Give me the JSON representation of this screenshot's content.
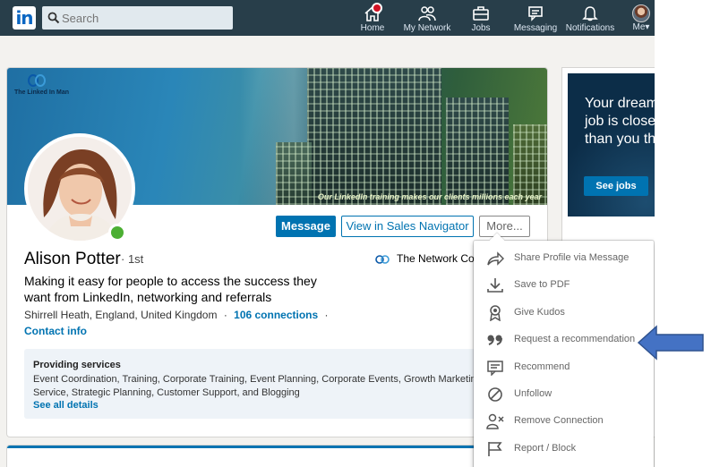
{
  "nav": {
    "logo_text": "in",
    "search_placeholder": "Search",
    "items": [
      {
        "label": "Home",
        "icon": "home-icon"
      },
      {
        "label": "My Network",
        "icon": "network-icon"
      },
      {
        "label": "Jobs",
        "icon": "briefcase-icon"
      },
      {
        "label": "Messaging",
        "icon": "messaging-icon"
      },
      {
        "label": "Notifications",
        "icon": "bell-icon"
      },
      {
        "label": "Me▾",
        "icon": "avatar"
      }
    ]
  },
  "banner": {
    "brand_name": "The Linked In Man",
    "tagline": "Our LinkedIn training makes our clients millions each year"
  },
  "profile": {
    "name": "Alison Potter",
    "degree": "· 1st",
    "headline": "Making it easy for people to access the success they want from LinkedIn, networking and referrals",
    "location": "Shirrell Heath, England, United Kingdom",
    "separator": "·",
    "connections": "106 connections",
    "trailing_separator": "·",
    "contact_info": "Contact info",
    "company": "The Network Coa"
  },
  "actions": {
    "message": "Message",
    "sales_navigator": "View in Sales Navigator",
    "more": "More..."
  },
  "services": {
    "title": "Providing services",
    "list": "Event Coordination, Training, Corporate Training, Event Planning, Corporate Events, Growth Marketing, Cu Service, Strategic Planning, Customer Support, and Blogging",
    "see_all": "See all details"
  },
  "ad": {
    "text": "Your dream job is closer than you think",
    "button": "See jobs"
  },
  "more_menu": {
    "items": [
      {
        "label": "Share Profile via Message",
        "icon": "share-arrow-icon"
      },
      {
        "label": "Save to PDF",
        "icon": "download-icon"
      },
      {
        "label": "Give Kudos",
        "icon": "award-ribbon-icon"
      },
      {
        "label": "Request a recommendation",
        "icon": "quote-icon"
      },
      {
        "label": "Recommend",
        "icon": "comment-icon"
      },
      {
        "label": "Unfollow",
        "icon": "block-circle-icon"
      },
      {
        "label": "Remove Connection",
        "icon": "remove-person-icon"
      },
      {
        "label": "Report / Block",
        "icon": "flag-icon"
      }
    ]
  },
  "colors": {
    "nav_bg": "#283e4a",
    "primary_blue": "#0073b1",
    "online_green": "#4caf33",
    "annotation_arrow": "#4472c4"
  }
}
